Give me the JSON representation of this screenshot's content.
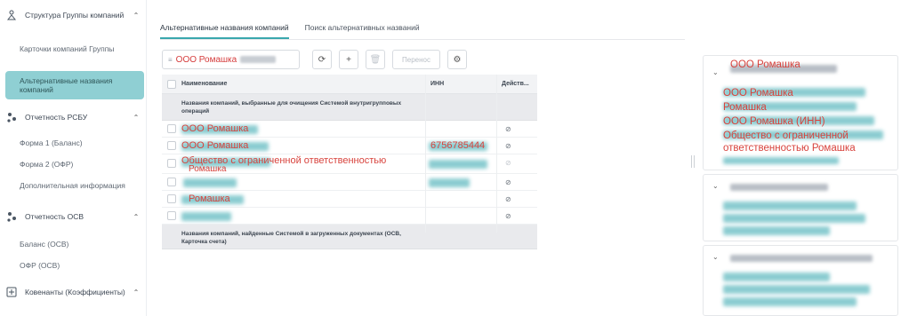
{
  "sidebar": {
    "sections": [
      {
        "label": "Структура Группы компаний",
        "icon": "org-structure-icon"
      },
      {
        "label": "Отчетность РСБУ",
        "icon": "hierarchy-icon"
      },
      {
        "label": "Отчетность ОСВ",
        "icon": "hierarchy-icon"
      },
      {
        "label": "Ковенанты (Коэффициенты)",
        "icon": "calculator-icon"
      }
    ],
    "items": [
      {
        "label": "Карточки компаний Группы"
      },
      {
        "label": "Альтернативные названия компаний",
        "active": true
      },
      {
        "label": "Форма 1 (Баланс)"
      },
      {
        "label": "Форма 2 (ОФР)"
      },
      {
        "label": "Дополнительная информация"
      },
      {
        "label": "Баланс (ОСВ)"
      },
      {
        "label": "ОФР (ОСВ)"
      }
    ]
  },
  "tabs": [
    {
      "label": "Альтернативные названия компаний",
      "active": true
    },
    {
      "label": "Поиск альтернативных названий",
      "active": false
    }
  ],
  "toolbar": {
    "search_value": "ООО Ромашка",
    "refresh_icon": "refresh-icon",
    "add_icon": "plus-icon",
    "delete_icon": "trash-icon",
    "transfer_label": "Перенос",
    "settings_icon": "gear-icon"
  },
  "table": {
    "columns": {
      "name": "Наименование",
      "inn": "ИНН",
      "actions": "Действ..."
    },
    "group1": "Названия компаний, выбранные для очищения Системой внутригрупповых операций",
    "rows": [
      {
        "name": "ООО Ромашка",
        "inn": ""
      },
      {
        "name": "ООО Ромашка",
        "inn": "6756785444"
      },
      {
        "name": "Общество с ограниченной ответственностью",
        "name2": "Ромашка",
        "inn": ""
      },
      {
        "name": "",
        "inn": ""
      },
      {
        "name": "Ромашка",
        "inn": ""
      },
      {
        "name": "",
        "inn": ""
      }
    ],
    "group2": "Названия компаний, найденные Системой в загруженных документах (ОСВ, Карточка счета)"
  },
  "right_panel": {
    "card1": {
      "header": "ООО Ромашка",
      "lines": [
        "ООО Ромашка",
        "Ромашка",
        "ООО Ромашка (ИНН)",
        "Общество с ограниченной",
        "ответственностью Ромашка"
      ]
    }
  },
  "colors": {
    "accent": "#3aa7ad",
    "active_bg": "#8fcfd3",
    "highlight_text": "#d8433d"
  }
}
